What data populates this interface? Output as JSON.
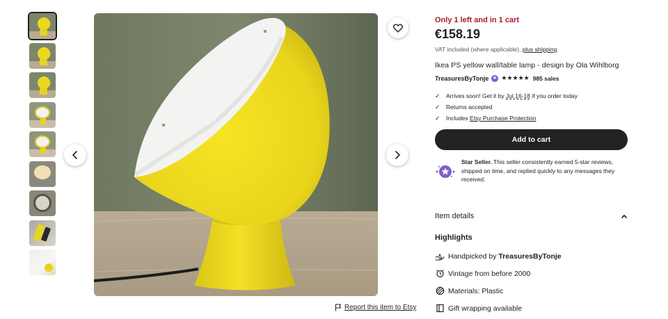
{
  "thumbnails": [
    {
      "name": "thumb-1",
      "variant": "t-lamp"
    },
    {
      "name": "thumb-2",
      "variant": "t-lamp"
    },
    {
      "name": "thumb-3",
      "variant": "t-lamp"
    },
    {
      "name": "thumb-4",
      "variant": "t-white"
    },
    {
      "name": "thumb-5",
      "variant": "t-white"
    },
    {
      "name": "thumb-6",
      "variant": "t-warm"
    },
    {
      "name": "thumb-7",
      "variant": "t-label"
    },
    {
      "name": "thumb-8",
      "variant": "t-plug"
    },
    {
      "name": "thumb-9",
      "variant": "t-inner"
    }
  ],
  "icons": {
    "prev": "chevron-left-icon",
    "next": "chevron-right-icon",
    "favorite": "heart-icon",
    "report": "flag-icon"
  },
  "report_label": "Report this item to Etsy",
  "listing": {
    "stock_notice": "Only 1 left and in 1 cart",
    "price": "€158.19",
    "vat_text": "VAT included (where applicable),",
    "shipping_link": "plus shipping",
    "title": "Ikea PS yellow wall/table lamp - design by Ola Wihlborg",
    "shop_name": "TreasuresByTonje",
    "rating_stars": "★★★★★",
    "sales": "985 sales"
  },
  "shipping": {
    "arrives_prefix": "Arrives soon! Get it by",
    "arrives_date": "Jul 16-18",
    "arrives_suffix": "if you order today",
    "returns": "Returns accepted",
    "protection_prefix": "Includes",
    "protection_link": "Etsy Purchase Protection"
  },
  "cart_button": "Add to cart",
  "star_seller": {
    "title": "Star Seller.",
    "text": "This seller consistently earned 5-star reviews, shipped on time, and replied quickly to any messages they received."
  },
  "item_details": {
    "label": "Item details",
    "highlights_label": "Highlights",
    "highlights": {
      "handpicked_prefix": "Handpicked by",
      "handpicked_shop": "TreasuresByTonje",
      "vintage": "Vintage from before 2000",
      "materials": "Materials: Plastic",
      "gift": "Gift wrapping available"
    }
  },
  "colors": {
    "accent_dark": "#222222",
    "stock_red": "#a61a2e",
    "star_seller_purple": "#7f5fc8",
    "lamp_yellow": "#f0dc1f"
  }
}
